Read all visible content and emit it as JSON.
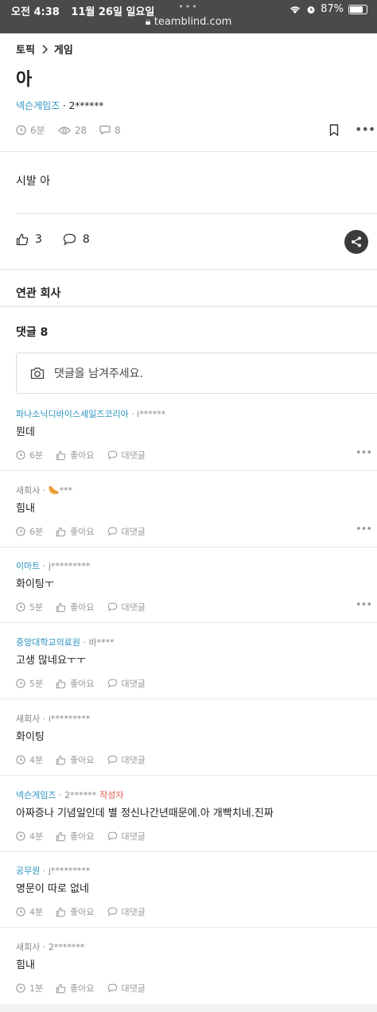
{
  "status_bar": {
    "time": "오전 4:38",
    "date": "11월 26일 일요일",
    "url": "teamblind.com",
    "battery": "87%"
  },
  "breadcrumb": {
    "topic": "토픽",
    "category": "게임"
  },
  "post": {
    "title": "아",
    "company": "넥슨게임즈",
    "author": "· 2******",
    "time": "6분",
    "views": "28",
    "comment_count": "8",
    "body": "시발 아",
    "likes": "3",
    "comments": "8"
  },
  "related_section": "연관 회사",
  "comments_header": "댓글 8",
  "comment_input_placeholder": "댓글을 남겨주세요.",
  "comment_actions": {
    "like": "좋아요",
    "reply": "대댓글"
  },
  "comments": [
    {
      "company": "파나소닉디바이스세일즈코리아",
      "company_link": true,
      "author": "· i******",
      "tag": "",
      "text": "뭔데",
      "time": "6분",
      "more": true
    },
    {
      "company": "새회사",
      "company_link": false,
      "author": "· 🌭***",
      "tag": "",
      "text": "힘내",
      "time": "6분",
      "more": true
    },
    {
      "company": "이마트",
      "company_link": true,
      "author": "· j*********",
      "tag": "",
      "text": "화이팅ㅜ",
      "time": "5분",
      "more": true
    },
    {
      "company": "중앙대학교의료원",
      "company_link": true,
      "author": "· 바****",
      "tag": "",
      "text": "고생 많네요ㅜㅜ",
      "time": "5분",
      "more": false
    },
    {
      "company": "새회사",
      "company_link": false,
      "author": "· i*********",
      "tag": "",
      "text": "화이팅",
      "time": "4분",
      "more": false
    },
    {
      "company": "넥슨게임즈",
      "company_link": true,
      "author": "· 2******",
      "tag": "작성자",
      "text": "아짜증나 기념일인데 별 정신나간년때문에.아 개빡치네.진짜",
      "time": "4분",
      "more": false
    },
    {
      "company": "공무원",
      "company_link": true,
      "author": "· j*********",
      "tag": "",
      "text": "명문이 따로 없네",
      "time": "4분",
      "more": false
    },
    {
      "company": "새회사",
      "company_link": false,
      "author": "· 2*******",
      "tag": "",
      "text": "힘내",
      "time": "1분",
      "more": false
    }
  ],
  "colors": {
    "company_link": "#2b93c0",
    "author_tag": "#e2574c",
    "status_bar": "#4a4a4a"
  }
}
